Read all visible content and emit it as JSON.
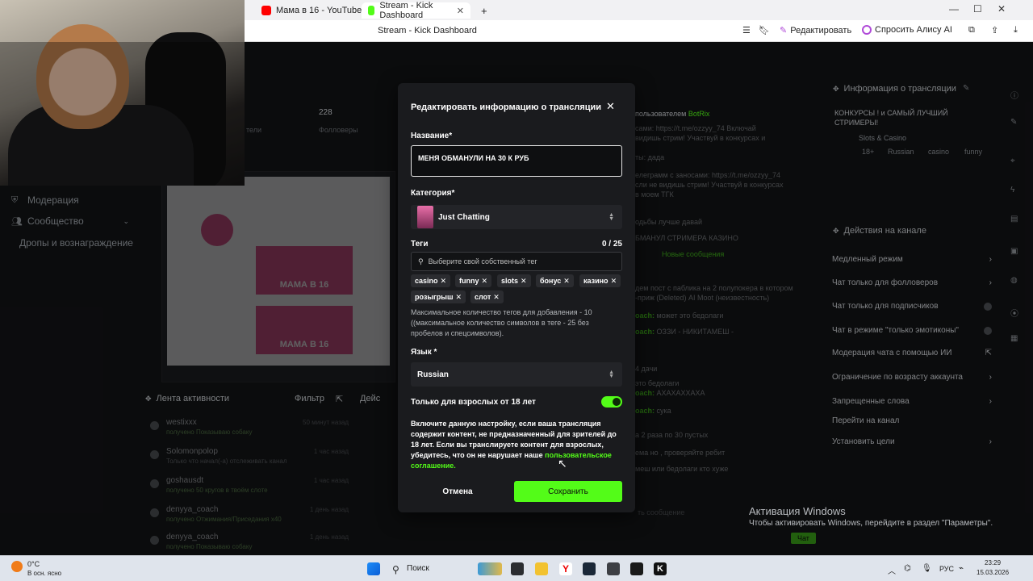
{
  "browser": {
    "tabs": [
      {
        "label": "Мама в 16 - YouTube",
        "active": false
      },
      {
        "label": "Stream - Kick Dashboard",
        "active": true
      }
    ],
    "page_title": "Stream - Kick Dashboard",
    "edit_label": "Редактировать",
    "alice_label": "Спросить Алису AI"
  },
  "dashboard": {
    "stats": {
      "count": "228",
      "followers": "Фолловеры",
      "viewers": "тели"
    },
    "sidebar": [
      {
        "label": "Модерация"
      },
      {
        "label": "Сообщество"
      },
      {
        "label": "Дропы и вознаграждение"
      }
    ],
    "activity": {
      "title": "Лента активности",
      "filter": "Фильтр",
      "rows": [
        {
          "user": "westixxx",
          "desc": "получено Показываю собаку",
          "time": "50 минут назад"
        },
        {
          "user": "Solomonpolop",
          "desc": "Только что начал(-а) отслеживать канал",
          "time": "1 час назад"
        },
        {
          "user": "goshausdt",
          "desc": "получено 50 кругов в твоём слоте",
          "time": "1 час назад"
        },
        {
          "user": "denyya_coach",
          "desc": "получено Отжимания/Приседания x40",
          "time": "1 день назад"
        },
        {
          "user": "denyya_coach",
          "desc": "получено Показываю собаку",
          "time": "1 день назад"
        }
      ]
    },
    "actions_title": "Дейс",
    "chat": {
      "pinned": "пользователем",
      "bot": "BotRix",
      "lines": [
        {
          "name": "",
          "text": "сами: https://t.me/ozzyy_74 Включай"
        },
        {
          "name": "",
          "text": "видишь стрим! Участвуй в конкурсах и"
        },
        {
          "name": "",
          "text": "ты: дада"
        },
        {
          "name": "",
          "text": "елеграмм с заносами: https://t.me/ozzyy_74"
        },
        {
          "name": "",
          "text": "сли не видишь стрим! Участвуй в конкурсах"
        },
        {
          "name": "",
          "text": "в моем ТГК"
        },
        {
          "name": "",
          "text": "одьбы лучше давай"
        },
        {
          "name": "",
          "text": "БМАНУЛ СТРИМЕРА КАЗИНО"
        },
        {
          "name": "",
          "text": "Новые сообщения"
        },
        {
          "name": "",
          "text": "дем пост с паблика на 2 полупокера в котором"
        },
        {
          "name": "",
          "text": "-приж (Deleted) AI Moot (неизвестность)"
        },
        {
          "name": "oach:",
          "text": "может это бедолаги"
        },
        {
          "name": "oach:",
          "text": "ОЗЗИ - НИКИТАМЕШ -"
        },
        {
          "name": "",
          "text": "4 дачи"
        },
        {
          "name": "",
          "text": "это бедолаги"
        },
        {
          "name": "oach:",
          "text": "АХАХАХХАХА"
        },
        {
          "name": "oach:",
          "text": "сука"
        },
        {
          "name": "",
          "text": "а 2 раза по 30 пустых"
        },
        {
          "name": "",
          "text": "ема но , проверяйте ребит"
        },
        {
          "name": "",
          "text": "меш или бедолаги кто хуже"
        }
      ],
      "send_placeholder": "ть сообщение",
      "send_label": "Чат"
    },
    "stream_info": {
      "title": "Информация о трансляции",
      "name": "КОНКУРСЫ ! и САМЫЙ ЛУЧШИЙ СТРИМЕРЫ!",
      "category": "Slots & Casino",
      "tags": [
        "18+",
        "Russian",
        "casino",
        "funny"
      ]
    },
    "channel_actions": {
      "title": "Действия на канале",
      "rows": [
        {
          "label": "Медленный режим"
        },
        {
          "label": "Чат только для фолловеров"
        },
        {
          "label": "Чат только для подписчиков"
        },
        {
          "label": "Чат в режиме \"только эмотиконы\""
        },
        {
          "label": "Модерация чата с помощью ИИ"
        },
        {
          "label": "Ограничение по возрасту аккаунта"
        },
        {
          "label": "Запрещенные слова"
        },
        {
          "label": "Перейти на канал"
        },
        {
          "label": "Установить цели"
        }
      ]
    }
  },
  "modal": {
    "title": "Редактировать информацию о трансляции",
    "name_label": "Название*",
    "name_value": "МЕНЯ ОБМАНУЛИ НА 30 К РУБ",
    "category_label": "Категория*",
    "category_value": "Just Chatting",
    "tags_label": "Теги",
    "tags_count": "0 / 25",
    "tags_placeholder": "Выберите свой собственный тег",
    "tags": [
      "casino",
      "funny",
      "slots",
      "бонус",
      "казино",
      "розыгрыш",
      "слот"
    ],
    "tags_hint": "Максимальное количество тегов для добавления - 10 ((максимальное количество символов в теге - 25 без пробелов и спецсимволов).",
    "language_label": "Язык *",
    "language_value": "Russian",
    "adult_label": "Только для взрослых от 18 лет",
    "adult_enabled": true,
    "adult_warning": "Включите данную настройку, если ваша трансляция содержит контент, не предназначенный для зрителей до 18 лет. Если вы транслируете контент для взрослых, убедитесь, что он не нарушает наше",
    "adult_link": "пользовательское соглашение.",
    "cancel_label": "Отмена",
    "save_label": "Сохранить"
  },
  "windows": {
    "activation_title": "Активация Windows",
    "activation_text": "Чтобы активировать Windows, перейдите в раздел \"Параметры\".",
    "weather_temp": "0°C",
    "weather_desc": "В осн. ясно",
    "search_label": "Поиск",
    "lang": "РУС",
    "time": "23:29",
    "date": "15.03.2026"
  },
  "colors": {
    "accent": "#53fc18",
    "modal_bg": "#1a1b1e",
    "page_bg": "#121315"
  }
}
